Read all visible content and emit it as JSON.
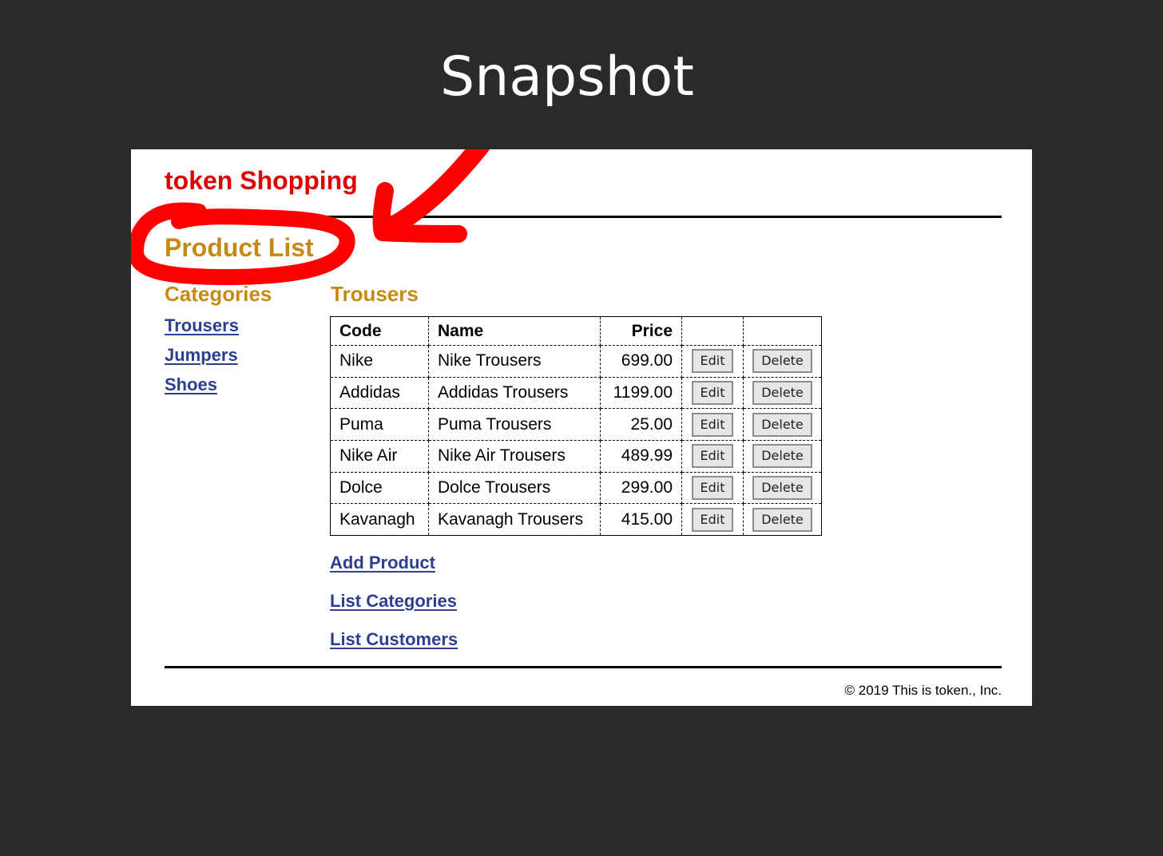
{
  "slide": {
    "title": "Snapshot"
  },
  "site": {
    "title": "token Shopping"
  },
  "page": {
    "heading": "Product List"
  },
  "sidebar": {
    "heading": "Categories",
    "items": [
      {
        "label": "Trousers"
      },
      {
        "label": "Jumpers"
      },
      {
        "label": "Shoes"
      }
    ]
  },
  "main": {
    "heading": "Trousers",
    "columns": {
      "code": "Code",
      "name": "Name",
      "price": "Price"
    },
    "edit_label": "Edit",
    "delete_label": "Delete",
    "rows": [
      {
        "code": "Nike",
        "name": "Nike Trousers",
        "price": "699.00"
      },
      {
        "code": "Addidas",
        "name": "Addidas Trousers",
        "price": "1199.00"
      },
      {
        "code": "Puma",
        "name": "Puma Trousers",
        "price": "25.00"
      },
      {
        "code": "Nike Air",
        "name": "Nike Air Trousers",
        "price": "489.99"
      },
      {
        "code": "Dolce",
        "name": "Dolce Trousers",
        "price": "299.00"
      },
      {
        "code": "Kavanagh",
        "name": "Kavanagh Trousers",
        "price": "415.00"
      }
    ],
    "actions": {
      "add_product": "Add Product",
      "list_categories": "List Categories",
      "list_customers": "List Customers"
    }
  },
  "footer": {
    "text": "© 2019 This is token., Inc."
  },
  "colors": {
    "background": "#2b292a",
    "site_title": "#e00000",
    "heading": "#c68a14",
    "link": "#2d3f8c",
    "annotation": "#ff0000"
  }
}
